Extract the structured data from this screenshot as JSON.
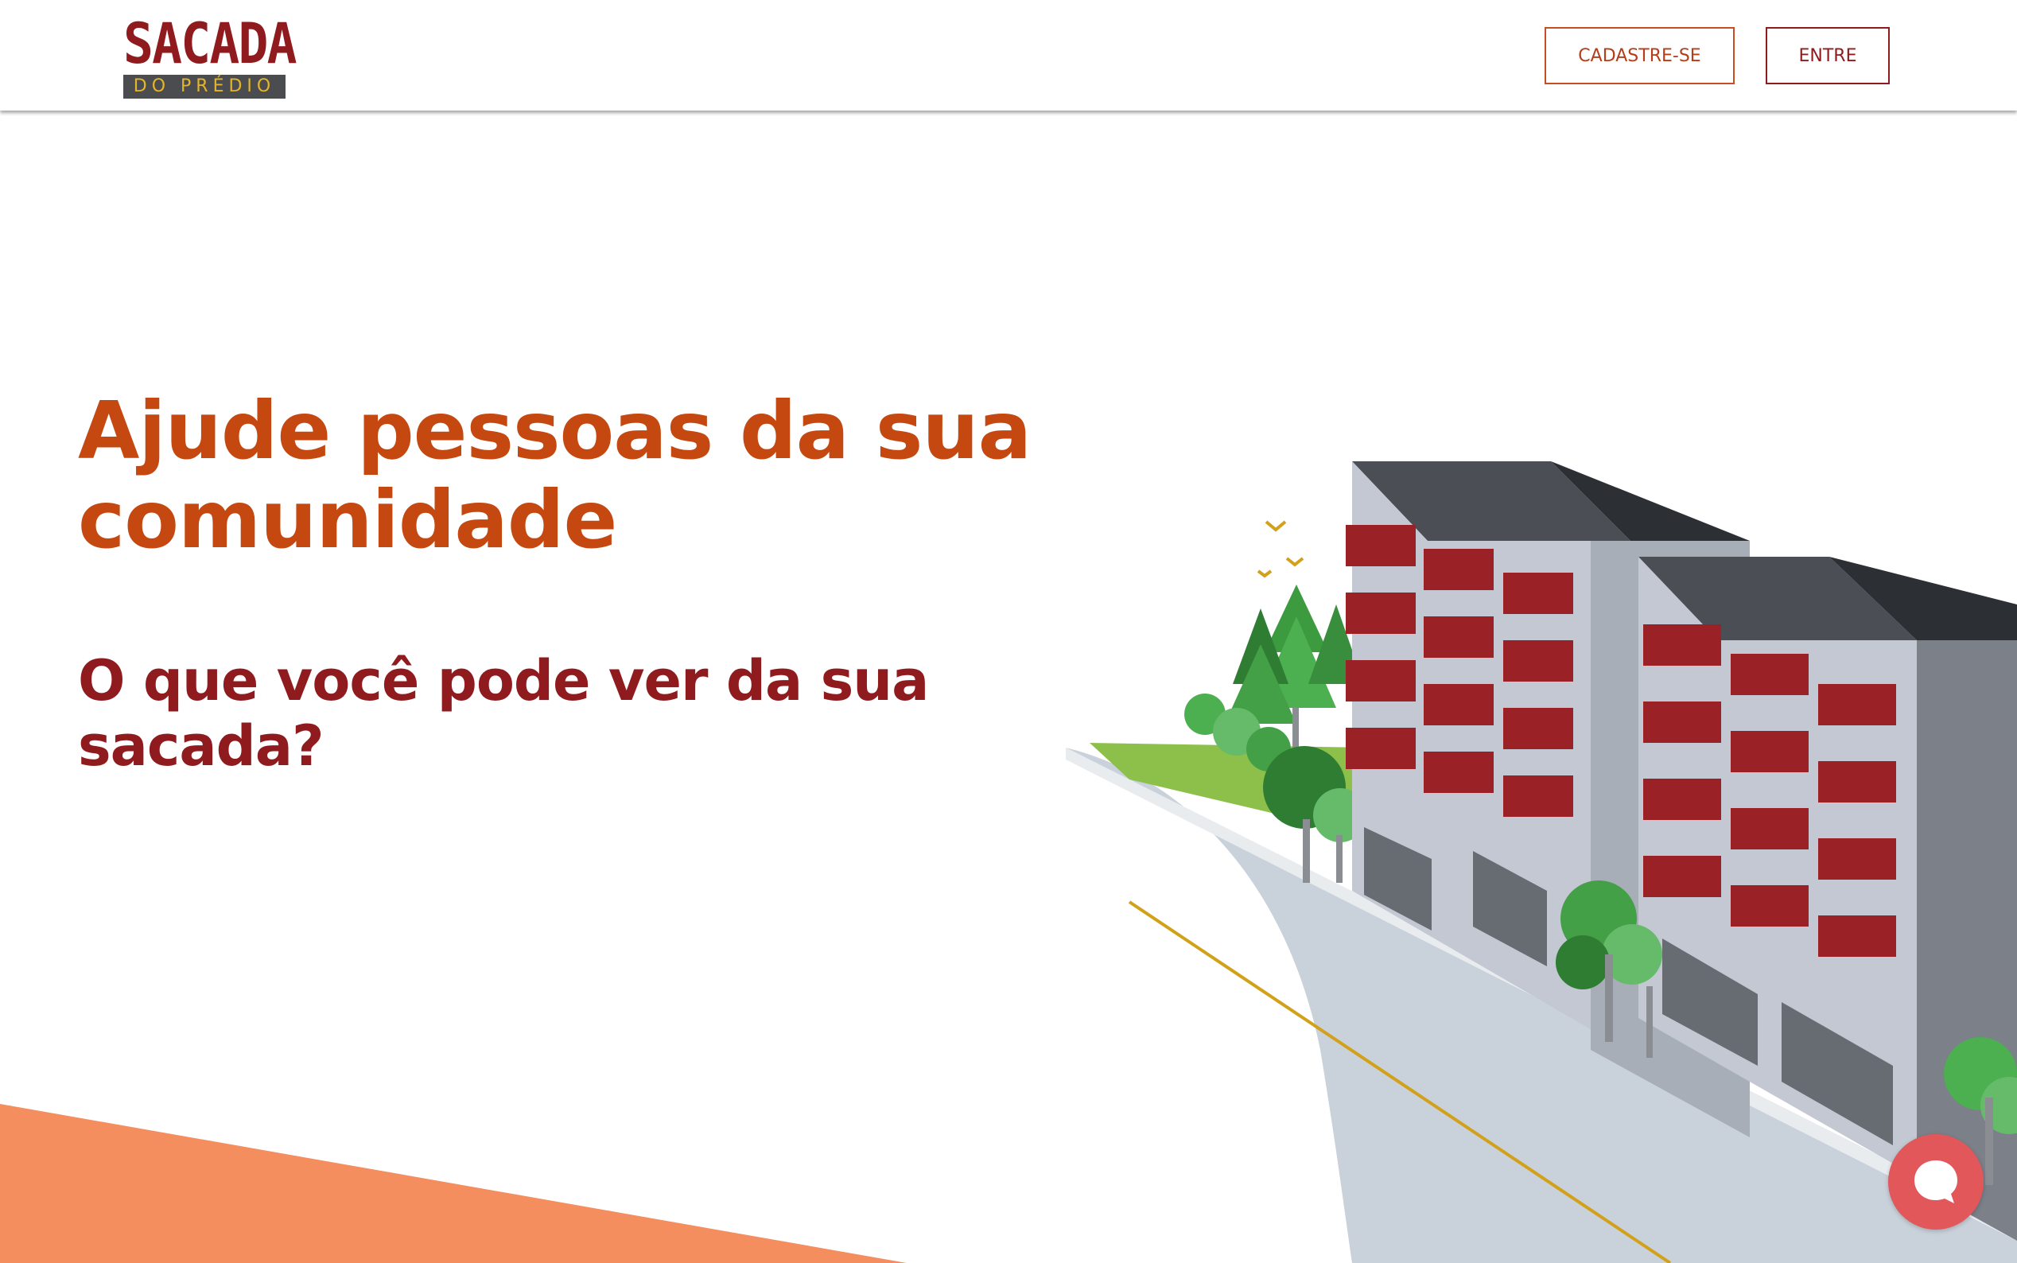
{
  "logo": {
    "top_text": "SACADA",
    "bottom_text": "DO PRÉDIO"
  },
  "nav": {
    "signup_label": "CADASTRE-SE",
    "login_label": "ENTRE"
  },
  "hero": {
    "title": "Ajude pessoas da sua comunidade",
    "subtitle": "O que você pode ver da sua sacada?"
  },
  "chat": {
    "icon": "chat-bubble-icon"
  },
  "colors": {
    "brand_red": "#8f1b1f",
    "brand_orange": "#c4480f",
    "accent_orange": "#f48e5f",
    "chat_red": "#e2575a"
  }
}
